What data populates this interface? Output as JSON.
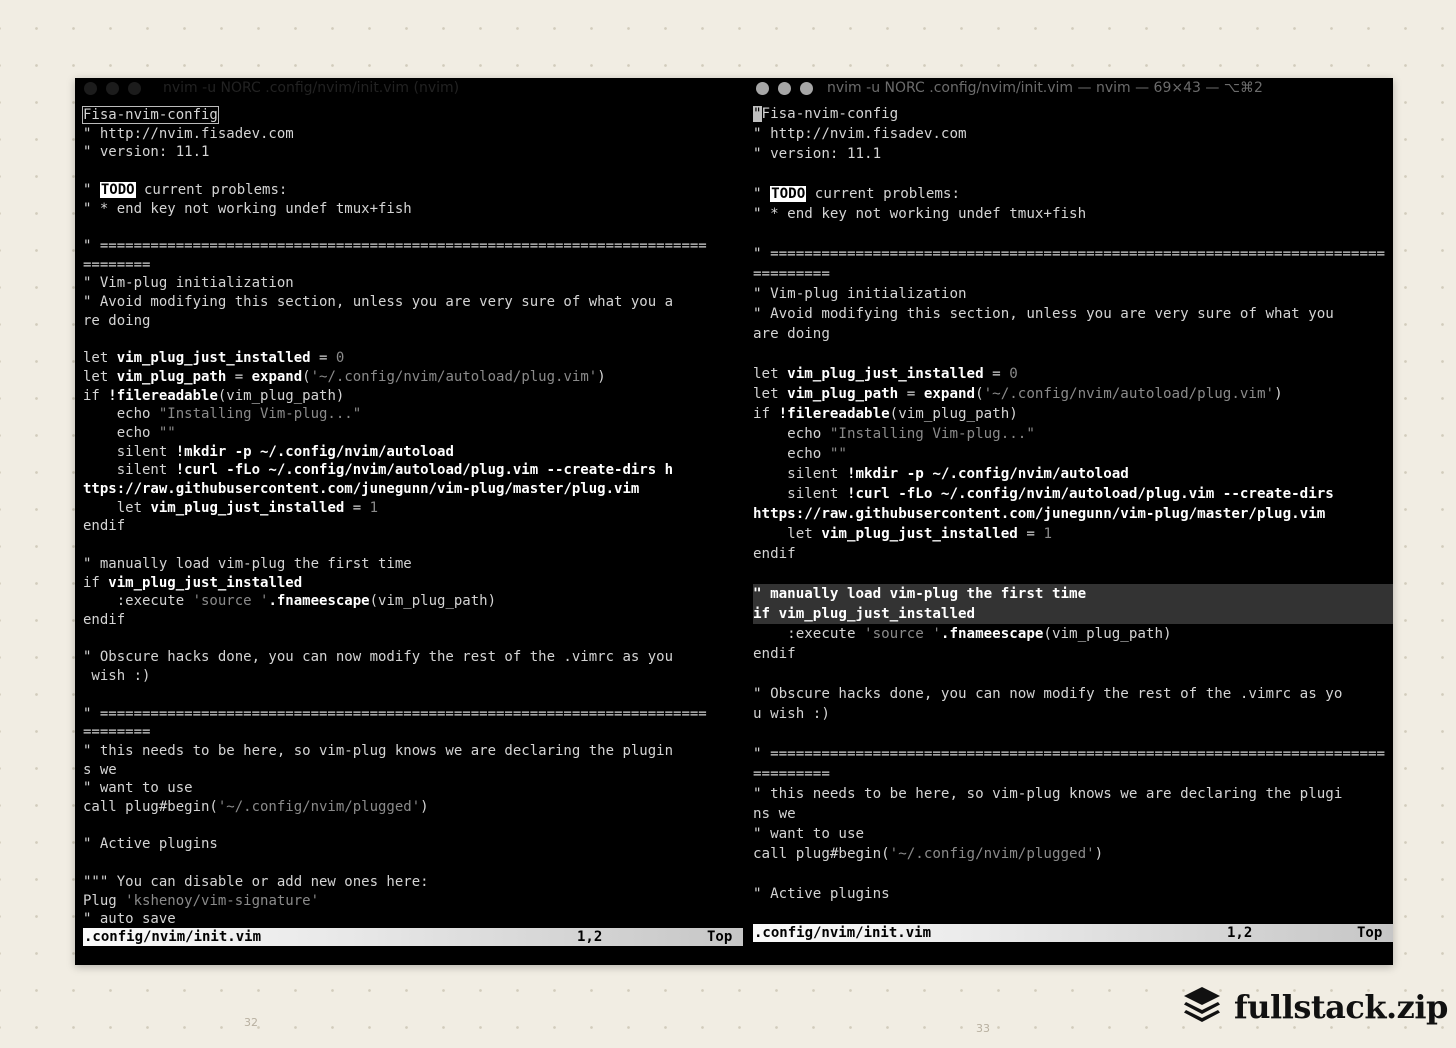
{
  "left_window": {
    "title": "nvim -u NORC .config/nvim/init.vim (nvim)",
    "status": {
      "file": ".config/nvim/init.vim",
      "position": "1,2",
      "scroll": "Top"
    },
    "lines": [
      [
        [
          "c",
          "Fisa-nvim-config",
          "cursorbox"
        ]
      ],
      [
        [
          "c",
          "\" http://nvim.fisadev.com"
        ]
      ],
      [
        [
          "c",
          "\" version: 11.1"
        ]
      ],
      [],
      [
        [
          "c",
          "\" "
        ],
        [
          "todo",
          "TODO"
        ],
        [
          "c",
          " current problems:"
        ]
      ],
      [
        [
          "c",
          "\" * end key not working undef tmux+fish"
        ]
      ],
      [],
      [
        [
          "c",
          "\" ========================================================================"
        ]
      ],
      [
        [
          "c",
          "========"
        ]
      ],
      [
        [
          "c",
          "\" Vim-plug initialization"
        ]
      ],
      [
        [
          "c",
          "\" Avoid modifying this section, unless you are very sure of what you a"
        ]
      ],
      [
        [
          "c",
          "re doing"
        ]
      ],
      [],
      [
        [
          "c",
          "let "
        ],
        [
          "b",
          "vim_plug_just_installed"
        ],
        [
          "c",
          " = "
        ],
        [
          "n",
          "0"
        ]
      ],
      [
        [
          "c",
          "let "
        ],
        [
          "b",
          "vim_plug_path"
        ],
        [
          "c",
          " = "
        ],
        [
          "b",
          "expand"
        ],
        [
          "c",
          "("
        ],
        [
          "s",
          "'~/.config/nvim/autoload/plug.vim'"
        ],
        [
          "c",
          ")"
        ]
      ],
      [
        [
          "c",
          "if "
        ],
        [
          "b",
          "!filereadable"
        ],
        [
          "c",
          "(vim_plug_path)"
        ]
      ],
      [
        [
          "c",
          "    echo "
        ],
        [
          "s",
          "\"Installing Vim-plug...\""
        ]
      ],
      [
        [
          "c",
          "    echo "
        ],
        [
          "s",
          "\"\""
        ]
      ],
      [
        [
          "c",
          "    silent "
        ],
        [
          "b",
          "!mkdir -p ~/.config/nvim/autoload"
        ]
      ],
      [
        [
          "c",
          "    silent "
        ],
        [
          "b",
          "!curl -fLo ~/.config/nvim/autoload/plug.vim --create-dirs h"
        ]
      ],
      [
        [
          "b",
          "ttps://raw.githubusercontent.com/junegunn/vim-plug/master/plug.vim"
        ]
      ],
      [
        [
          "c",
          "    let "
        ],
        [
          "b",
          "vim_plug_just_installed"
        ],
        [
          "c",
          " = "
        ],
        [
          "n",
          "1"
        ]
      ],
      [
        [
          "c",
          "endif"
        ]
      ],
      [],
      [
        [
          "c",
          "\" manually load vim-plug the first time"
        ]
      ],
      [
        [
          "c",
          "if "
        ],
        [
          "b",
          "vim_plug_just_installed"
        ]
      ],
      [
        [
          "c",
          "    :execute "
        ],
        [
          "s",
          "'source '"
        ],
        [
          "b",
          ".fnameescape"
        ],
        [
          "c",
          "(vim_plug_path)"
        ]
      ],
      [
        [
          "c",
          "endif"
        ]
      ],
      [],
      [
        [
          "c",
          "\" Obscure hacks done, you can now modify the rest of the .vimrc as you"
        ]
      ],
      [
        [
          "c",
          " wish :)"
        ]
      ],
      [],
      [
        [
          "c",
          "\" ========================================================================"
        ]
      ],
      [
        [
          "c",
          "========"
        ]
      ],
      [
        [
          "c",
          "\" this needs to be here, so vim-plug knows we are declaring the plugin"
        ]
      ],
      [
        [
          "c",
          "s we"
        ]
      ],
      [
        [
          "c",
          "\" want to use"
        ]
      ],
      [
        [
          "c",
          "call plug#begin("
        ],
        [
          "s",
          "'~/.config/nvim/plugged'"
        ],
        [
          "c",
          ")"
        ]
      ],
      [],
      [
        [
          "c",
          "\" Active plugins"
        ]
      ],
      [],
      [
        [
          "c",
          "\"\"\" You can disable or add new ones here:"
        ]
      ],
      [
        [
          "c",
          "Plug "
        ],
        [
          "s",
          "'kshenoy/vim-signature'"
        ]
      ],
      [
        [
          "c",
          "\" auto save"
        ]
      ]
    ]
  },
  "right_window": {
    "title": "nvim -u NORC .config/nvim/init.vim — nvim — 69×43 — ⌥⌘2",
    "status": {
      "file": ".config/nvim/init.vim",
      "position": "1,2",
      "scroll": "Top"
    },
    "lines": [
      [
        [
          "cursor",
          "\""
        ],
        [
          "c",
          "Fisa-nvim-config"
        ]
      ],
      [
        [
          "c",
          "\" http://nvim.fisadev.com"
        ]
      ],
      [
        [
          "c",
          "\" version: 11.1"
        ]
      ],
      [],
      [
        [
          "c",
          "\" "
        ],
        [
          "todo",
          "TODO"
        ],
        [
          "c",
          " current problems:"
        ]
      ],
      [
        [
          "c",
          "\" * end key not working undef tmux+fish"
        ]
      ],
      [],
      [
        [
          "c",
          "\" ========================================================================"
        ]
      ],
      [
        [
          "c",
          "========="
        ]
      ],
      [
        [
          "c",
          "\" Vim-plug initialization"
        ]
      ],
      [
        [
          "c",
          "\" Avoid modifying this section, unless you are very sure of what you"
        ]
      ],
      [
        [
          "c",
          "are doing"
        ]
      ],
      [],
      [
        [
          "c",
          "let "
        ],
        [
          "b",
          "vim_plug_just_installed"
        ],
        [
          "c",
          " = "
        ],
        [
          "n",
          "0"
        ]
      ],
      [
        [
          "c",
          "let "
        ],
        [
          "b",
          "vim_plug_path"
        ],
        [
          "c",
          " = "
        ],
        [
          "b",
          "expand"
        ],
        [
          "c",
          "("
        ],
        [
          "s",
          "'~/.config/nvim/autoload/plug.vim'"
        ],
        [
          "c",
          ")"
        ]
      ],
      [
        [
          "c",
          "if "
        ],
        [
          "b",
          "!filereadable"
        ],
        [
          "c",
          "(vim_plug_path)"
        ]
      ],
      [
        [
          "c",
          "    echo "
        ],
        [
          "s",
          "\"Installing Vim-plug...\""
        ]
      ],
      [
        [
          "c",
          "    echo "
        ],
        [
          "s",
          "\"\""
        ]
      ],
      [
        [
          "c",
          "    silent "
        ],
        [
          "b",
          "!mkdir -p ~/.config/nvim/autoload"
        ]
      ],
      [
        [
          "c",
          "    silent "
        ],
        [
          "b",
          "!curl -fLo ~/.config/nvim/autoload/plug.vim --create-dirs"
        ]
      ],
      [
        [
          "b",
          "https://raw.githubusercontent.com/junegunn/vim-plug/master/plug.vim"
        ]
      ],
      [
        [
          "c",
          "    let "
        ],
        [
          "b",
          "vim_plug_just_installed"
        ],
        [
          "c",
          " = "
        ],
        [
          "n",
          "1"
        ]
      ],
      [
        [
          "c",
          "endif"
        ]
      ],
      [],
      [
        [
          "hl",
          "\" manually load vim-plug the first time"
        ]
      ],
      [
        [
          "hl",
          "if vim_plug_just_installed"
        ]
      ],
      [
        [
          "c",
          "    :execute "
        ],
        [
          "s",
          "'source '"
        ],
        [
          "b",
          ".fnameescape"
        ],
        [
          "c",
          "(vim_plug_path)"
        ]
      ],
      [
        [
          "c",
          "endif"
        ]
      ],
      [],
      [
        [
          "c",
          "\" Obscure hacks done, you can now modify the rest of the .vimrc as yo"
        ]
      ],
      [
        [
          "c",
          "u wish :)"
        ]
      ],
      [],
      [
        [
          "c",
          "\" ========================================================================"
        ]
      ],
      [
        [
          "c",
          "========="
        ]
      ],
      [
        [
          "c",
          "\" this needs to be here, so vim-plug knows we are declaring the plugi"
        ]
      ],
      [
        [
          "c",
          "ns we"
        ]
      ],
      [
        [
          "c",
          "\" want to use"
        ]
      ],
      [
        [
          "c",
          "call plug#begin("
        ],
        [
          "s",
          "'~/.config/nvim/plugged'"
        ],
        [
          "c",
          ")"
        ]
      ],
      [],
      [
        [
          "c",
          "\" Active plugins"
        ]
      ]
    ]
  },
  "slide": {
    "page_left": "32",
    "page_right": "33",
    "brand": "fullstack.zip",
    "brand_icon": "layers-stack-icon"
  }
}
